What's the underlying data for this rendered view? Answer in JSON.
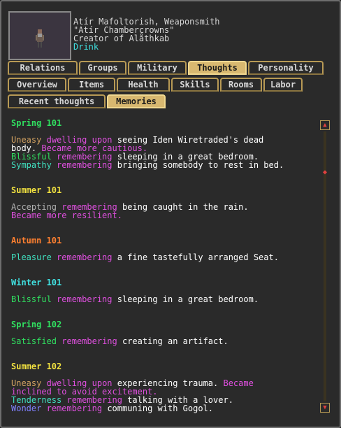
{
  "header": {
    "name": "Atír Mafoltorish, Weaponsmith",
    "nickname": "\"Atír Chambercrowns\"",
    "title": "Creator of Alåthkab",
    "status": "Drink"
  },
  "colors": {
    "spring": "#30e060",
    "summer": "#f0e040",
    "autumn": "#ff8030",
    "winter": "#40e0e0",
    "uneasy": "#d0a060",
    "emotion_cyan": "#40e0c0",
    "mauve": "#e050e0",
    "wonder": "#8080ff",
    "accepting": "#b0b0b0",
    "white": "#ffffff",
    "blissful": "#30e060"
  },
  "tabs_row1": [
    "Relations",
    "Groups",
    "Military",
    "Thoughts",
    "Personality"
  ],
  "tabs_row2": [
    "Overview",
    "Items",
    "Health",
    "Skills",
    "Rooms",
    "Labor"
  ],
  "tabs_row3": [
    "Recent thoughts",
    "Memories"
  ],
  "memories": {
    "spring101": "Spring 101",
    "l1a": "Uneasy",
    "l1b": "dwelling upon",
    "l1c": "seeing Iden Wiretraded's dead",
    "l2a": "body.",
    "l2b": "Became more cautious.",
    "l3a": "Blissful",
    "l3b": "remembering",
    "l3c": "sleeping in a great bedroom.",
    "l4a": "Sympathy",
    "l4b": "remembering",
    "l4c": "bringing somebody to rest in bed.",
    "summer101": "Summer 101",
    "l5a": "Accepting",
    "l5b": "remembering",
    "l5c": "being caught in the rain.",
    "l6a": "Became more resilient.",
    "autumn101": "Autumn 101",
    "l7a": "Pleasure",
    "l7b": "remembering",
    "l7c": "a fine tastefully arranged Seat.",
    "winter101": "Winter 101",
    "l8a": "Blissful",
    "l8b": "remembering",
    "l8c": "sleeping in a great bedroom.",
    "spring102": "Spring 102",
    "l9a": "Satisfied",
    "l9b": "remembering",
    "l9c": "creating an artifact.",
    "summer102": "Summer 102",
    "l10a": "Uneasy",
    "l10b": "dwelling upon",
    "l10c": "experiencing trauma.",
    "l10d": "Became",
    "l11a": "inclined to avoid excitement.",
    "l12a": "Tenderness",
    "l12b": "remembering",
    "l12c": "talking with a lover.",
    "l13a": "Wonder",
    "l13b": "remembering",
    "l13c": "communing with Gogol."
  },
  "scrollbar": {
    "up": "▲",
    "down": "▼",
    "thumb": "◆"
  }
}
